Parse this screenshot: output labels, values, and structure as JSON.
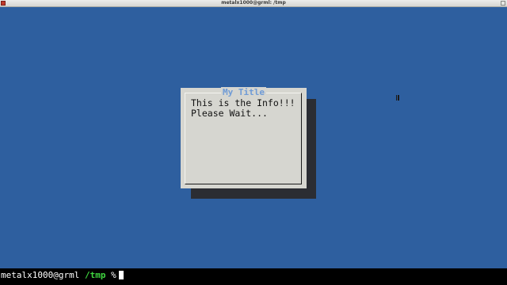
{
  "window": {
    "title": "metalx1000@grml: /tmp"
  },
  "dialog": {
    "title": "My Title",
    "lines": [
      "This is the Info!!!",
      "Please Wait..."
    ]
  },
  "prompt": {
    "user": "metalx1000",
    "at": "@",
    "host": "grml",
    "path": "/tmp",
    "symbol": "%"
  },
  "colors": {
    "terminal_background": "#2e5f9f",
    "dialog_background": "#d6d6d0",
    "dialog_title": "#6f9bd6",
    "dialog_shadow": "#2b2d33",
    "prompt_path": "#3fd43f"
  },
  "icons": {
    "app": "terminal-app-icon",
    "cursor": "text-cursor-icon"
  }
}
